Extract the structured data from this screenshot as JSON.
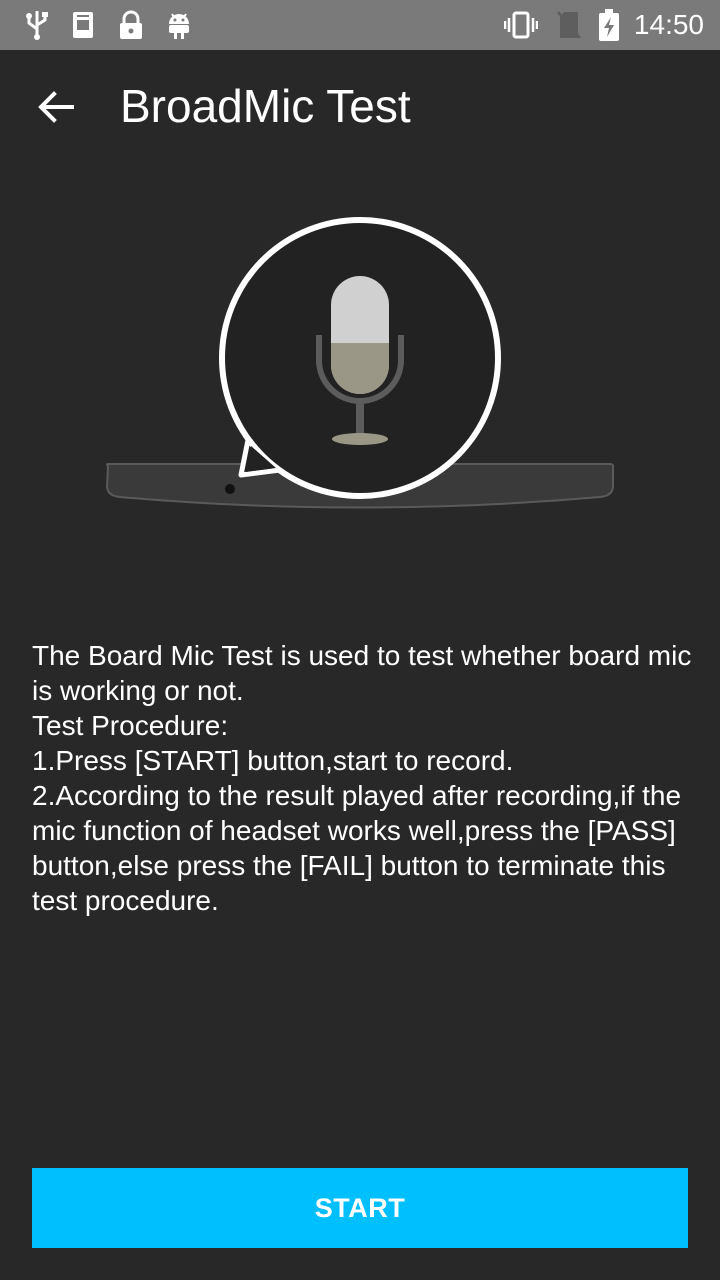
{
  "status_bar": {
    "time": "14:50",
    "icons": [
      "usb-icon",
      "notification-icon",
      "lock-icon",
      "android-icon",
      "vibrate-icon",
      "no-sim-icon",
      "battery-charging-icon"
    ]
  },
  "app_bar": {
    "title": "BroadMic Test",
    "back_icon": "arrow-back-icon"
  },
  "description": "The Board Mic Test is used to test whether board mic is working or not.\nTest Procedure:\n1.Press [START] button,start to record.\n2.According to the result played after recording,if the mic function of headset works well,press the [PASS] button,else press the [FAIL] button to terminate this test procedure.",
  "start_button": {
    "label": "START"
  },
  "colors": {
    "background": "#282828",
    "status_bar": "#7a7a7a",
    "accent": "#00bfff"
  }
}
